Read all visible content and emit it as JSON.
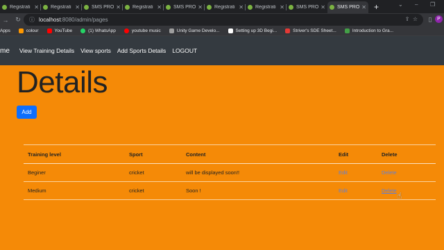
{
  "browser": {
    "tabs": [
      {
        "title": "Registrati"
      },
      {
        "title": "Registrati"
      },
      {
        "title": "SMS PRO"
      },
      {
        "title": "Registrati"
      },
      {
        "title": "SMS PRO"
      },
      {
        "title": "Registrati"
      },
      {
        "title": "Registrati"
      },
      {
        "title": "SMS PRO"
      },
      {
        "title": "SMS PRO",
        "active": true
      }
    ],
    "new_tab": "+",
    "url_host": "localhost",
    "url_path": ":8080/admin/pages",
    "profile_initial": "P",
    "bookmarks": [
      {
        "label": "Apps",
        "color": "#4285f4"
      },
      {
        "label": "colour",
        "color": "#ff9800"
      },
      {
        "label": "YouTube",
        "color": "#ff0000"
      },
      {
        "label": "(1) WhatsApp",
        "color": "#25d366"
      },
      {
        "label": "youtube music",
        "color": "#ff0000"
      },
      {
        "label": "Unity Game Develo...",
        "color": "#9e9e9e"
      },
      {
        "label": "Setting up 3D Begi...",
        "color": "#ffffff"
      },
      {
        "label": "Striver's SDE Sheet...",
        "color": "#e53935"
      },
      {
        "label": "Introduction to Gra...",
        "color": "#43a047"
      }
    ]
  },
  "navbar": {
    "brand": "me",
    "links": [
      "View Training Details",
      "View sports",
      "Add Sports Details",
      "LOGOUT"
    ]
  },
  "page": {
    "title": "Details",
    "add_button": "Add"
  },
  "table": {
    "headers": [
      "Training level",
      "Sport",
      "Content",
      "Edit",
      "Delete"
    ],
    "rows": [
      {
        "level": "Beginer",
        "sport": "cricket",
        "content": "will be displayed soon!!",
        "edit": "Edit",
        "delete": "Delete"
      },
      {
        "level": "Medium",
        "sport": "cricket",
        "content": "Soon !",
        "edit": "Edit",
        "delete": "Delete"
      }
    ]
  },
  "colors": {
    "page_bg": "#f58a07",
    "navbar_bg": "#343a40",
    "add_button_bg": "#0d6efd",
    "link": "#5f7fd8"
  }
}
